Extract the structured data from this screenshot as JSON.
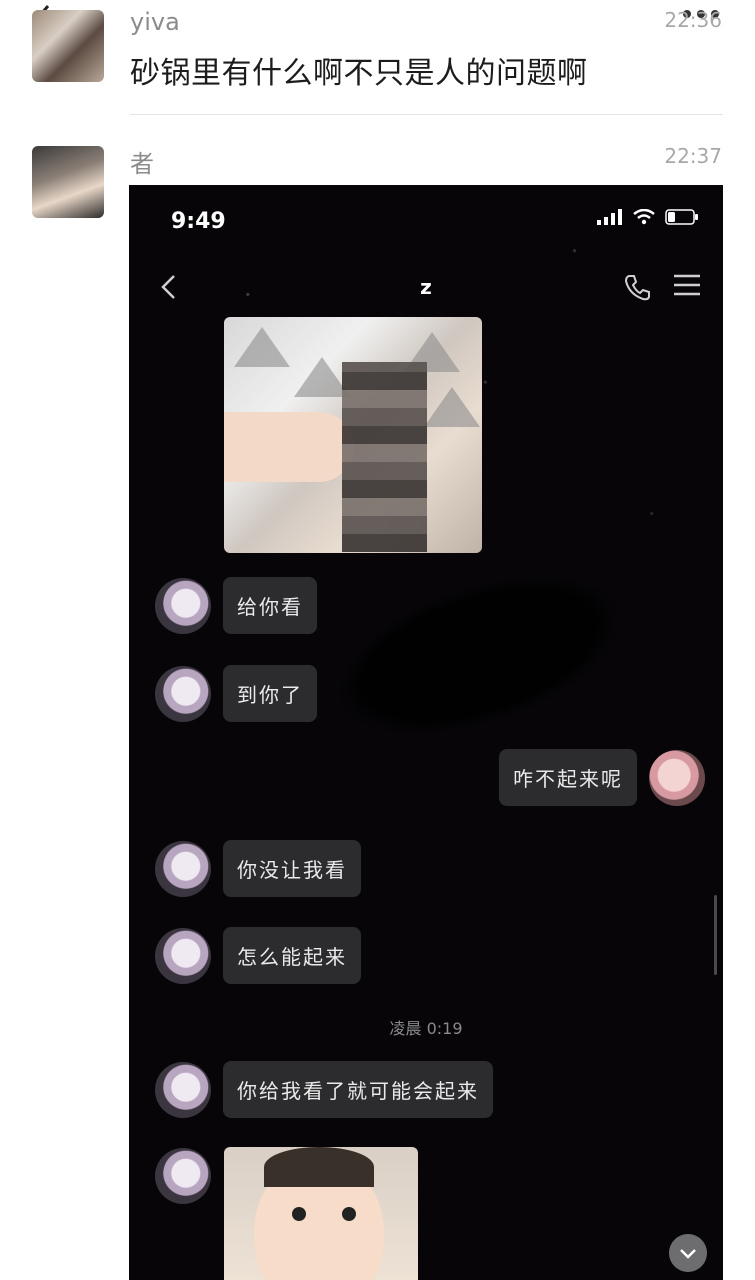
{
  "header": {
    "back_icon": "back-arrow-icon",
    "more_icon": "more-dots-icon"
  },
  "posts": [
    {
      "username": "yiva",
      "time": "22:36",
      "text": "砂锅里有什么啊不只是人的问题啊"
    },
    {
      "username": "者",
      "time": "22:37"
    }
  ],
  "screenshot": {
    "status_time": "9:49",
    "chat_title": "z",
    "messages": [
      {
        "side": "left",
        "text": "给你看"
      },
      {
        "side": "left",
        "text": "到你了"
      },
      {
        "side": "right",
        "text": "咋不起来呢"
      },
      {
        "side": "left",
        "text": "你没让我看"
      },
      {
        "side": "left",
        "text": "怎么能起来"
      },
      {
        "side": "left",
        "text": "你给我看了就可能会起来"
      }
    ],
    "timestamp": "凌晨 0:19"
  }
}
